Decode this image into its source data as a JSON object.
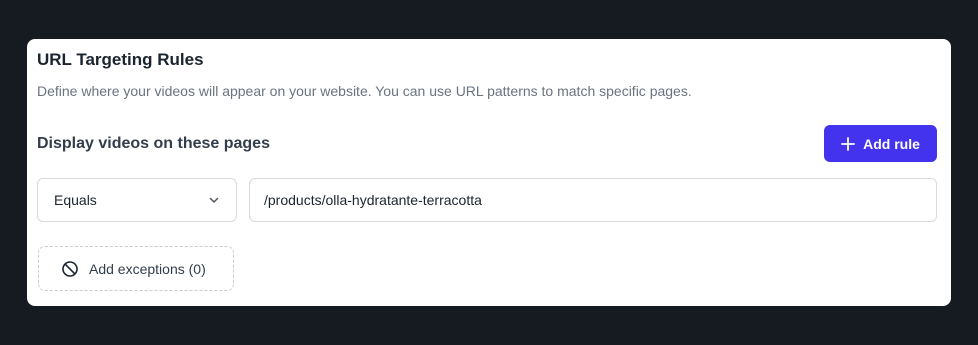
{
  "card": {
    "title": "URL Targeting Rules",
    "description": "Define where your videos will appear on your website. You can use URL patterns to match specific pages."
  },
  "rules": {
    "section_title": "Display videos on these pages",
    "add_rule_label": "Add rule",
    "match_type": {
      "selected": "Equals"
    },
    "url_value": "/products/olla-hydratante-terracotta",
    "exceptions_label": "Add exceptions (0)"
  },
  "icons": {
    "add": "plus-icon",
    "dropdown": "chevron-down-icon",
    "exceptions": "ban-icon"
  },
  "colors": {
    "background": "#161b22",
    "card": "#ffffff",
    "accent": "#4433ee"
  }
}
